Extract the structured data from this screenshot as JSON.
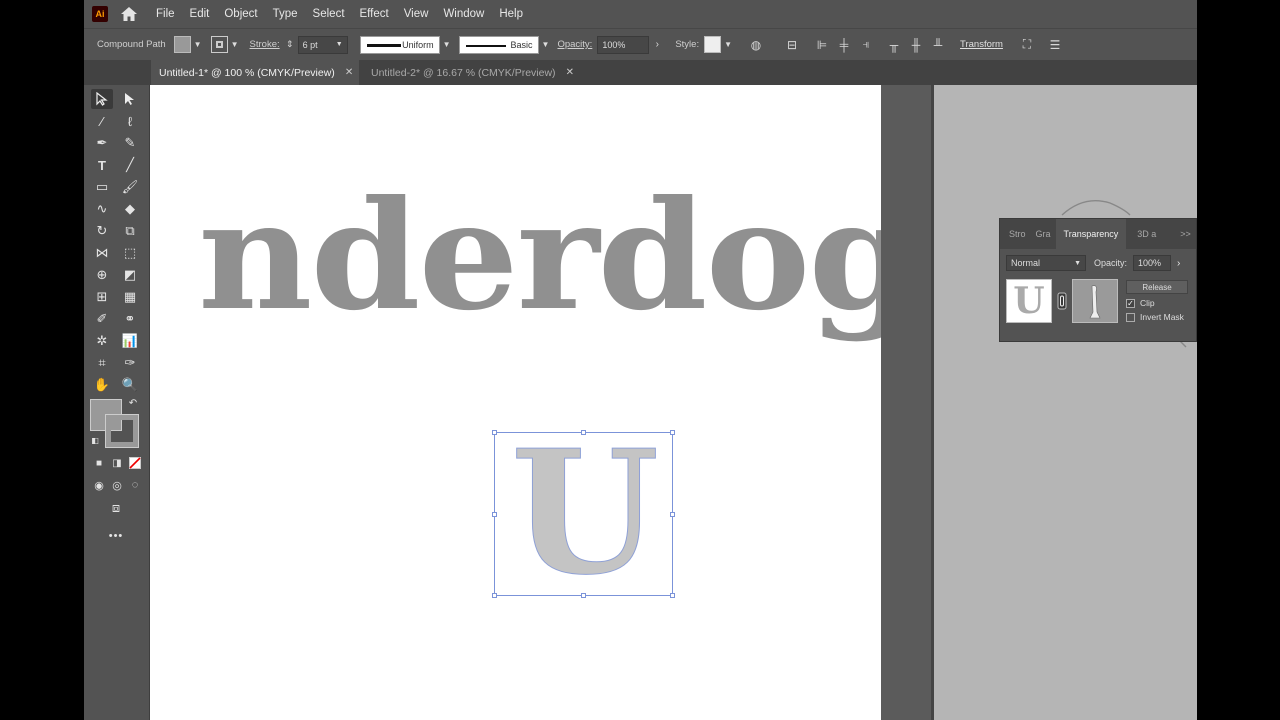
{
  "app": {
    "logo_text": "Ai"
  },
  "menu": [
    "File",
    "Edit",
    "Object",
    "Type",
    "Select",
    "Effect",
    "View",
    "Window",
    "Help"
  ],
  "control_bar": {
    "selection_type": "Compound Path",
    "stroke_label": "Stroke:",
    "stroke_weight": "6 pt",
    "stroke_profile": "Uniform",
    "brush_def": "Basic",
    "opacity_label": "Opacity:",
    "opacity_value": "100%",
    "style_label": "Style:",
    "transform_label": "Transform"
  },
  "tabs": [
    {
      "label": "Untitled-1* @ 100 % (CMYK/Preview)",
      "active": true
    },
    {
      "label": "Untitled-2* @ 16.67 % (CMYK/Preview)",
      "active": false
    }
  ],
  "artwork": {
    "word": "nderdog",
    "letter": "U"
  },
  "transparency_panel": {
    "tabs": [
      "Stro",
      "Gra",
      "Transparency",
      "3D a"
    ],
    "overflow": ">>",
    "blend_mode": "Normal",
    "opacity_label": "Opacity:",
    "opacity_value": "100%",
    "release_label": "Release",
    "clip_label": "Clip",
    "clip_checked": true,
    "invert_mask_label": "Invert Mask",
    "invert_checked": false
  },
  "colors": {
    "ui_bg": "#535353",
    "artboard": "#ffffff",
    "word_fill": "#909090",
    "selection": "#7b93d9",
    "logo_bg": "#330000",
    "logo_fg": "#ff9a00"
  }
}
